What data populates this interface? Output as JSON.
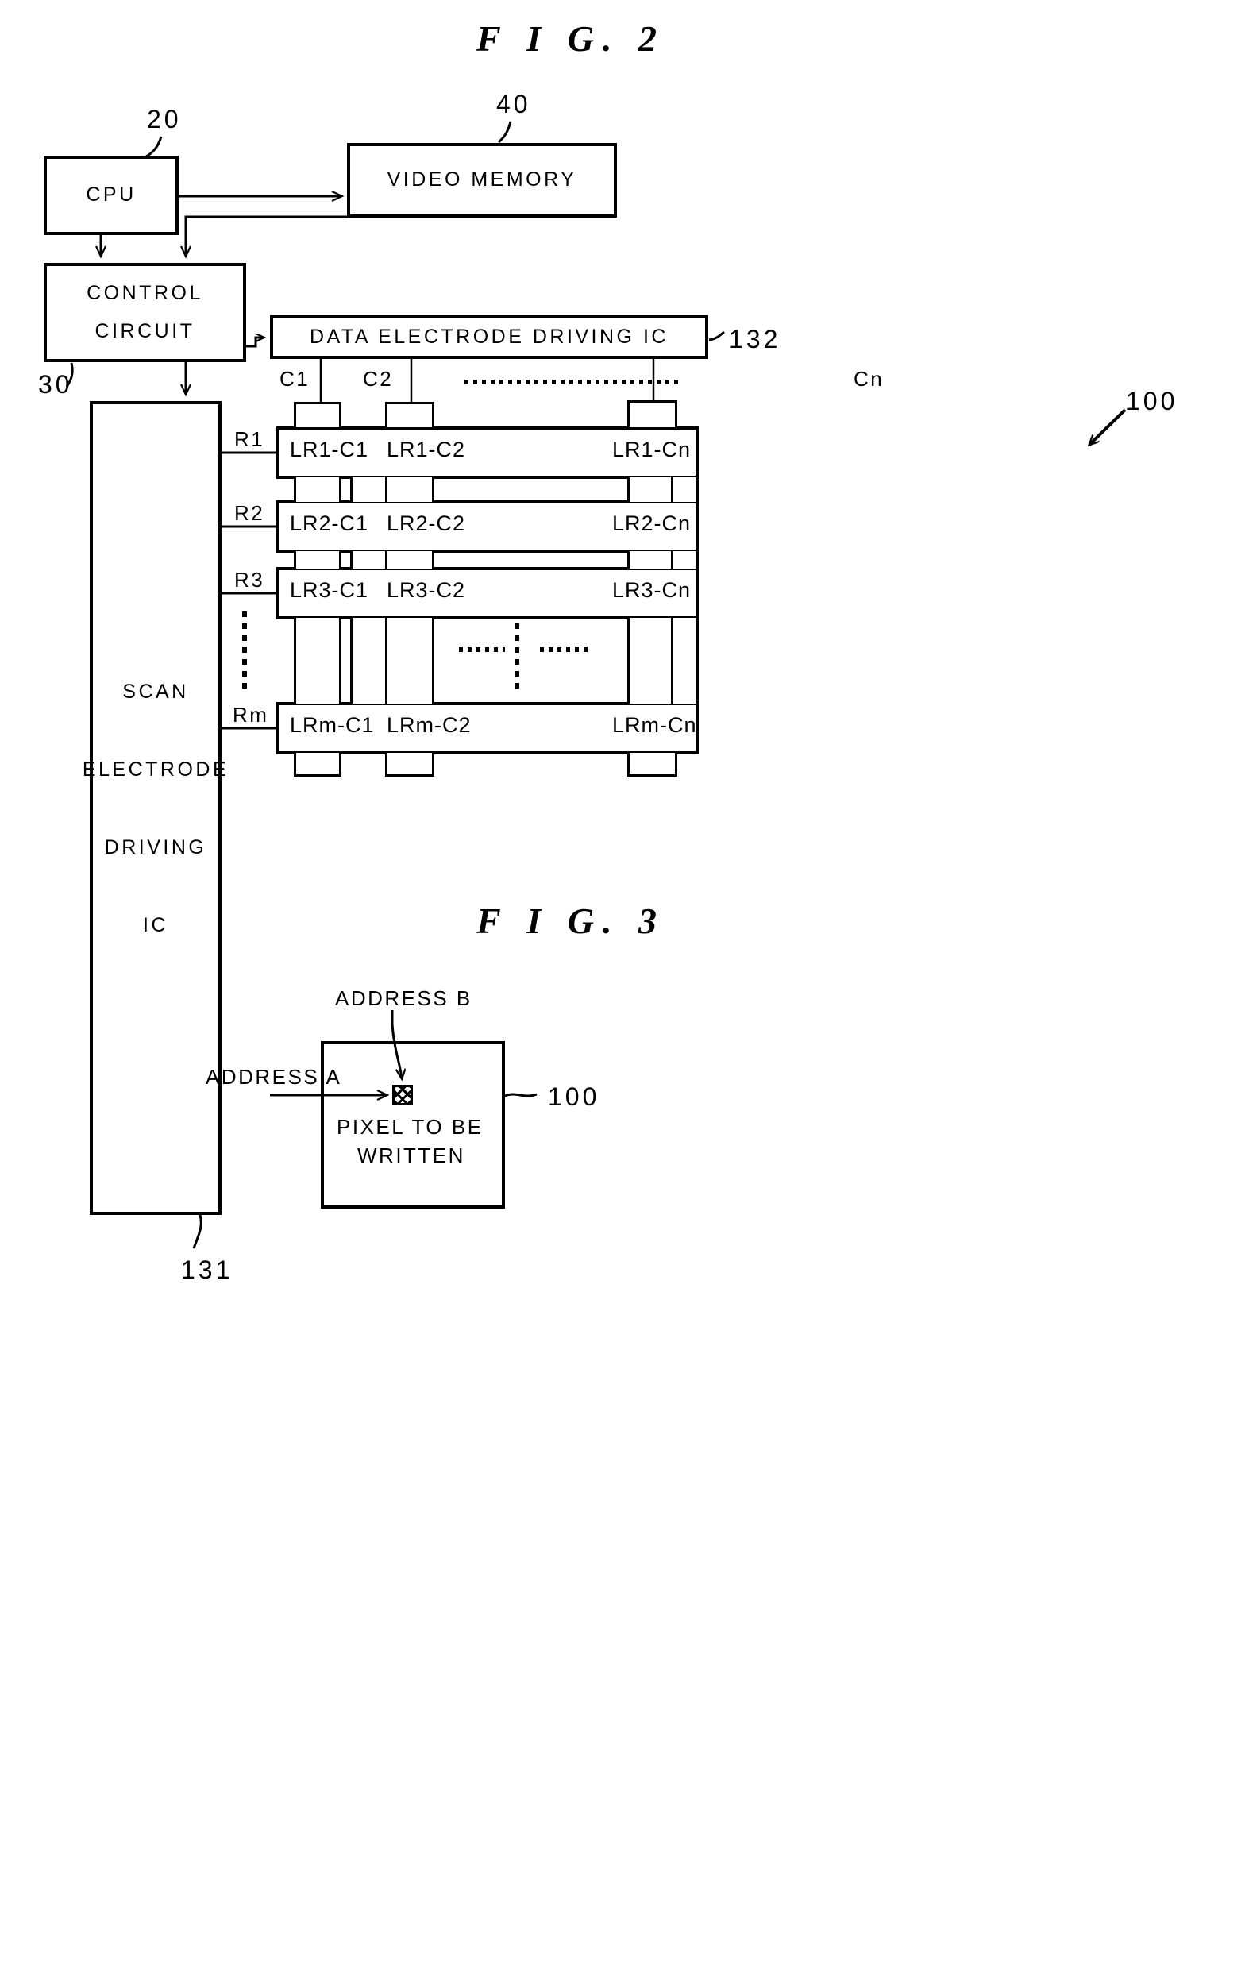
{
  "figures": [
    {
      "id": "fig2",
      "title": "F I G. 2"
    },
    {
      "id": "fig3",
      "title": "F I G. 3"
    }
  ],
  "fig2": {
    "title": "F I G. 2",
    "blocks": {
      "cpu": {
        "label": "CPU",
        "ref": "20"
      },
      "video_memory": {
        "label": "VIDEO MEMORY",
        "ref": "40"
      },
      "control_circuit": {
        "label": "CONTROL CIRCUIT",
        "ref": "30"
      },
      "data_driver": {
        "label": "DATA ELECTRODE DRIVING IC",
        "ref": "132"
      },
      "scan_driver": {
        "label_line1": "SCAN",
        "label_line2": "ELECTRODE",
        "label_line3": "DRIVING",
        "label_line4": "IC",
        "ref": "131"
      },
      "panel": {
        "ref": "100"
      }
    },
    "column_labels": [
      "C1",
      "C2",
      "Cn"
    ],
    "column_ellipsis": "",
    "row_labels": [
      "R1",
      "R2",
      "R3",
      "Rm"
    ],
    "panel_rows": [
      {
        "row": "R1",
        "cells": [
          "LR1-C1",
          "LR1-C2",
          "LR1-Cn"
        ]
      },
      {
        "row": "R2",
        "cells": [
          "LR2-C1",
          "LR2-C2",
          "LR2-Cn"
        ]
      },
      {
        "row": "R3",
        "cells": [
          "LR3-C1",
          "LR3-C2",
          "LR3-Cn"
        ]
      },
      {
        "row": "Rm",
        "cells": [
          "LRm-C1",
          "LRm-C2",
          "LRm-Cn"
        ]
      }
    ]
  },
  "fig3": {
    "title": "F I G. 3",
    "panel_ref": "100",
    "address_a": "ADDRESS A",
    "address_b": "ADDRESS B",
    "pixel_caption_line1": "PIXEL TO BE",
    "pixel_caption_line2": "WRITTEN"
  },
  "colors": {
    "ink": "#000000",
    "paper": "#ffffff"
  }
}
